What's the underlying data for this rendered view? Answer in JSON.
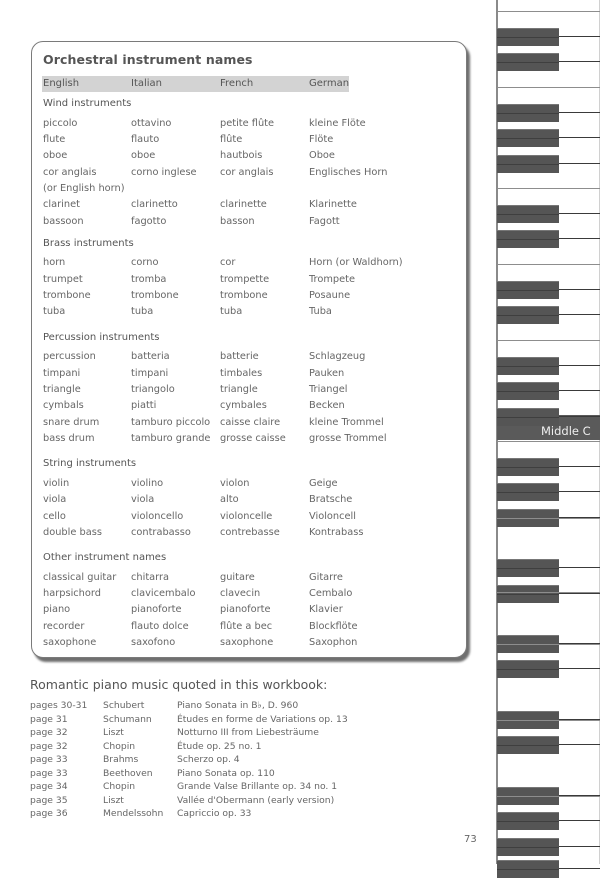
{
  "panel": {
    "title": "Orchestral instrument names",
    "columns": [
      "English",
      "Italian",
      "French",
      "German"
    ],
    "sections": [
      {
        "name": "Wind instruments",
        "rows": [
          [
            "piccolo",
            "ottavino",
            "petite flûte",
            "kleine Flöte"
          ],
          [
            "flute",
            "flauto",
            "flûte",
            "Flöte"
          ],
          [
            "oboe",
            "oboe",
            "hautbois",
            "Oboe"
          ],
          [
            "cor anglais",
            "corno inglese",
            "cor anglais",
            "Englisches Horn"
          ],
          [
            "(or English horn)",
            "",
            "",
            ""
          ],
          [
            "clarinet",
            "clarinetto",
            "clarinette",
            "Klarinette"
          ],
          [
            "bassoon",
            "fagotto",
            "basson",
            "Fagott"
          ]
        ]
      },
      {
        "name": "Brass instruments",
        "rows": [
          [
            "horn",
            "corno",
            "cor",
            "Horn (or Waldhorn)"
          ],
          [
            "trumpet",
            "tromba",
            "trompette",
            "Trompete"
          ],
          [
            "trombone",
            "trombone",
            "trombone",
            "Posaune"
          ],
          [
            "tuba",
            "tuba",
            "tuba",
            "Tuba"
          ]
        ]
      },
      {
        "name": "Percussion instruments",
        "rows": [
          [
            "percussion",
            "batteria",
            "batterie",
            "Schlagzeug"
          ],
          [
            "timpani",
            "timpani",
            "timbales",
            "Pauken"
          ],
          [
            "triangle",
            "triangolo",
            "triangle",
            "Triangel"
          ],
          [
            "cymbals",
            "piatti",
            "cymbales",
            "Becken"
          ],
          [
            "snare drum",
            "tamburo piccolo",
            "caisse claire",
            "kleine Trommel"
          ],
          [
            "bass drum",
            "tamburo grande",
            "grosse caisse",
            "grosse Trommel"
          ]
        ]
      },
      {
        "name": "String instruments",
        "rows": [
          [
            "violin",
            "violino",
            "violon",
            "Geige"
          ],
          [
            "viola",
            "viola",
            "alto",
            "Bratsche"
          ],
          [
            "cello",
            "violoncello",
            "violoncelle",
            "Violoncell"
          ],
          [
            "double bass",
            "contrabasso",
            "contrebasse",
            "Kontrabass"
          ]
        ]
      },
      {
        "name": "Other instrument names",
        "rows": [
          [
            "classical guitar",
            "chitarra",
            "guitare",
            "Gitarre"
          ],
          [
            "harpsichord",
            "clavicembalo",
            "clavecin",
            "Cembalo"
          ],
          [
            "piano",
            "pianoforte",
            "pianoforte",
            "Klavier"
          ],
          [
            "recorder",
            "flauto dolce",
            "flûte a bec",
            "Blockflöte"
          ],
          [
            "saxophone",
            "saxofono",
            "saxophone",
            "Saxophon"
          ]
        ]
      }
    ]
  },
  "romantic": {
    "title": "Romantic piano music quoted in this workbook:",
    "rows": [
      [
        "pages 30-31",
        "Schubert",
        "Piano Sonata in B♭, D. 960"
      ],
      [
        "page 31",
        "Schumann",
        "Études en forme de Variations op. 13"
      ],
      [
        "page 32",
        "Liszt",
        "Notturno III from Liebesträume"
      ],
      [
        "page 32",
        "Chopin",
        "Étude op. 25 no. 1"
      ],
      [
        "page 33",
        "Brahms",
        "Scherzo op. 4"
      ],
      [
        "page 33",
        "Beethoven",
        "Piano Sonata op. 110"
      ],
      [
        "page 34",
        "Chopin",
        "Grande Valse Brillante op. 34 no. 1"
      ],
      [
        "page 35",
        "Liszt",
        "Vallée d'Obermann (early version)"
      ],
      [
        "page 36",
        "Mendelssohn",
        "Capriccio op. 33"
      ]
    ]
  },
  "keyboard": {
    "middle_c_label": "Middle C"
  },
  "page_number": "73"
}
